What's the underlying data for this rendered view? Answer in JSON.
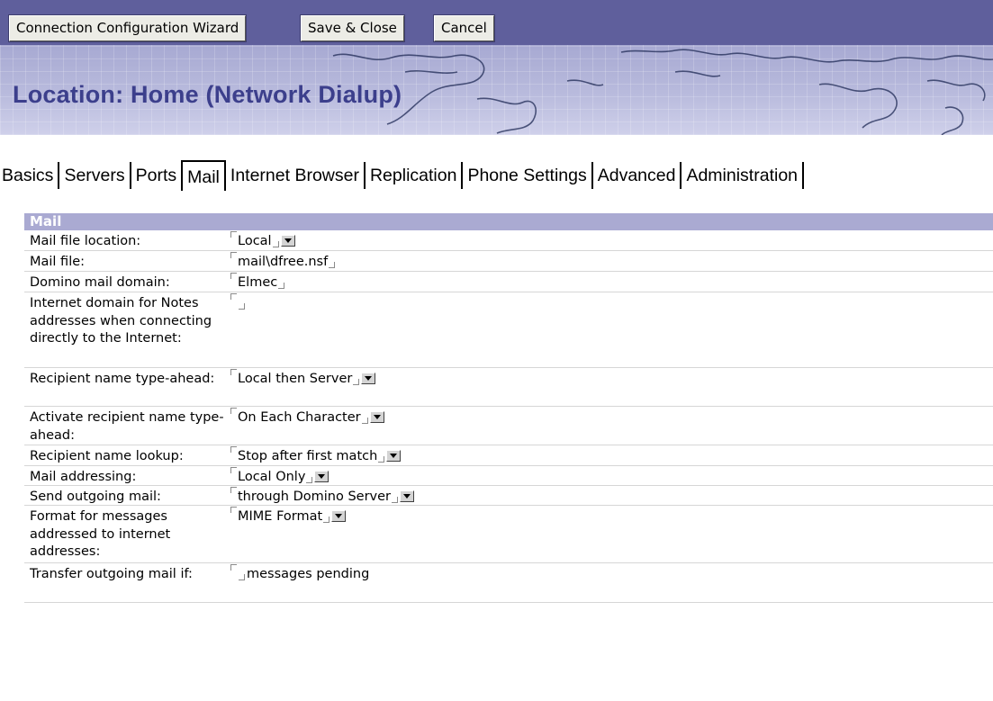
{
  "toolbar": {
    "wizard_label": "Connection Configuration Wizard",
    "save_close_label": "Save & Close",
    "cancel_label": "Cancel"
  },
  "page": {
    "title": "Location: Home (Network Dialup)"
  },
  "tabs": [
    {
      "label": "Basics"
    },
    {
      "label": "Servers"
    },
    {
      "label": "Ports"
    },
    {
      "label": "Mail",
      "active": true
    },
    {
      "label": "Internet Browser"
    },
    {
      "label": "Replication"
    },
    {
      "label": "Phone Settings"
    },
    {
      "label": "Advanced"
    },
    {
      "label": "Administration"
    }
  ],
  "section": {
    "title": "Mail"
  },
  "fields": {
    "mail_file_location": {
      "label": "Mail file location:",
      "value": "Local"
    },
    "mail_file": {
      "label": "Mail file:",
      "value": "mail\\dfree.nsf"
    },
    "domino_mail_domain": {
      "label": "Domino mail domain:",
      "value": "Elmec"
    },
    "internet_domain": {
      "label": "Internet domain for Notes addresses when connecting directly to the Internet:",
      "value": ""
    },
    "recipient_type_ahead": {
      "label": "Recipient name type-ahead:",
      "value": "Local then Server"
    },
    "activate_type_ahead": {
      "label": "Activate recipient name type-ahead:",
      "value": "On Each Character"
    },
    "recipient_lookup": {
      "label": "Recipient name lookup:",
      "value": "Stop after first match"
    },
    "mail_addressing": {
      "label": "Mail addressing:",
      "value": "Local Only"
    },
    "send_outgoing": {
      "label": "Send outgoing mail:",
      "value": "through Domino Server"
    },
    "format_messages": {
      "label": "Format for messages addressed to internet addresses:",
      "value": "MIME Format"
    },
    "transfer_outgoing": {
      "label": "Transfer outgoing mail if:",
      "value": "",
      "suffix": "messages pending"
    }
  },
  "colors": {
    "toolbar_bg": "#5f5f9c",
    "header_bg": "#9a9cc8",
    "title_color": "#3c3f8c",
    "section_bar": "#aaaad2"
  },
  "icons": {
    "dropdown": "dropdown-arrow-icon",
    "field_bracket": "field-bracket-icon"
  }
}
